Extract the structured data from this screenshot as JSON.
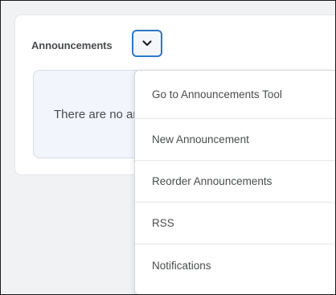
{
  "widget": {
    "title": "Announcements",
    "menu_toggle_icon": "chevron-down-icon",
    "empty_message": "There are no announcements to display."
  },
  "dropdown": {
    "items": [
      {
        "label": "Go to Announcements Tool"
      },
      {
        "label": "New Announcement"
      },
      {
        "label": "Reorder Announcements"
      },
      {
        "label": "RSS"
      },
      {
        "label": "Notifications"
      }
    ]
  },
  "colors": {
    "focus_ring": "#2b78c5",
    "text": "#494c4e",
    "card_bg": "#f2f5fb"
  }
}
